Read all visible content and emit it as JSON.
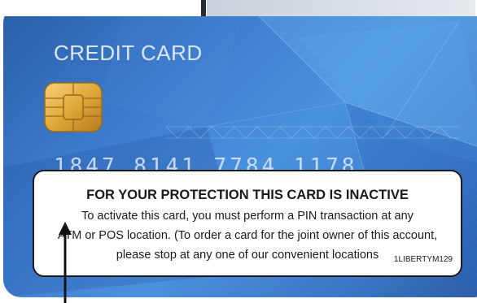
{
  "card": {
    "title": "CREDIT CARD",
    "number_row": "1847  8141  7784  1178"
  },
  "sticker": {
    "heading": "FOR YOUR PROTECTION THIS CARD IS INACTIVE",
    "line1": "To activate this card, you must perform a PIN transaction at any",
    "line2": "ATM or POS location. (To order a card for the joint owner of this account,",
    "line3": "please stop at any one of our convenient locations",
    "code": "1LIBERTYM129"
  },
  "icons": {
    "chip": "emv-chip-icon",
    "arrow": "up-arrow-icon"
  },
  "colors": {
    "card_blue": "#3d7ccd",
    "chip_gold": "#e0a83a",
    "sticker_text": "#1a1a1a"
  }
}
